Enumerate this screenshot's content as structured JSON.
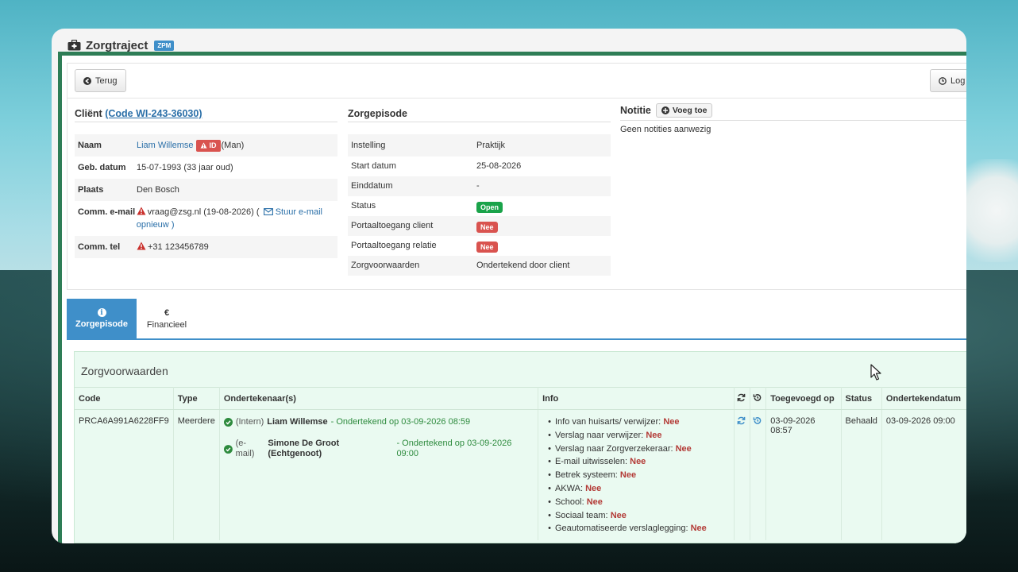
{
  "window": {
    "title": "Zorgtraject",
    "badge": "ZPM"
  },
  "toolbar": {
    "back_label": "Terug",
    "log_label": "Log"
  },
  "client": {
    "heading": "Cliënt",
    "code_link": "(Code WI-243-36030)",
    "rows": {
      "naam_label": "Naam",
      "naam_value": "Liam Willemse",
      "id_badge": "ID",
      "gender": "(Man)",
      "dob_label": "Geb. datum",
      "dob_value": "15-07-1993 (33 jaar oud)",
      "plaats_label": "Plaats",
      "plaats_value": "Den Bosch",
      "email_label": "Comm. e-mail",
      "email_value": "vraag@zsg.nl (19-08-2026) (",
      "email_link": "Stuur e-mail opnieuw",
      "email_suffix": ")",
      "tel_label": "Comm. tel",
      "tel_value": "+31 123456789"
    }
  },
  "episode": {
    "heading": "Zorgepisode",
    "rows": [
      {
        "label": "Instelling",
        "value": "Praktijk"
      },
      {
        "label": "Start datum",
        "value": "25-08-2026"
      },
      {
        "label": "Einddatum",
        "value": "-"
      },
      {
        "label": "Status",
        "badge": "Open"
      },
      {
        "label": "Portaaltoegang client",
        "badge": "Nee"
      },
      {
        "label": "Portaaltoegang relatie",
        "badge": "Nee"
      },
      {
        "label": "Zorgvoorwaarden",
        "value": "Ondertekend door client"
      }
    ]
  },
  "notes": {
    "heading": "Notitie",
    "add_label": "Voeg toe",
    "empty_text": "Geen notities aanwezig"
  },
  "tabs": [
    {
      "icon": "i",
      "label": "Zorgepisode"
    },
    {
      "icon": "€",
      "label": "Financieel"
    }
  ],
  "conditions": {
    "title": "Zorgvoorwaarden",
    "headers": {
      "code": "Code",
      "type": "Type",
      "signers": "Ondertekenaar(s)",
      "info": "Info",
      "added": "Toegevoegd op",
      "status": "Status",
      "signed_date": "Ondertekendatum"
    },
    "row": {
      "code": "PRCA6A991A6228FF9",
      "type": "Meerdere",
      "signers": [
        {
          "type": "(Intern)",
          "name": "Liam Willemse",
          "status": "- Ondertekend op 03-09-2026 08:59"
        },
        {
          "type": "(e-mail)",
          "name": "Simone De Groot (Echtgenoot)",
          "status": "- Ondertekend op 03-09-2026 09:00"
        }
      ],
      "info": [
        {
          "label": "Info van huisarts/ verwijzer:",
          "value": "Nee"
        },
        {
          "label": "Verslag naar verwijzer:",
          "value": "Nee"
        },
        {
          "label": "Verslag naar Zorgverzekeraar:",
          "value": "Nee"
        },
        {
          "label": "E-mail uitwisselen:",
          "value": "Nee"
        },
        {
          "label": "Betrek systeem:",
          "value": "Nee"
        },
        {
          "label": "AKWA:",
          "value": "Nee"
        },
        {
          "label": "School:",
          "value": "Nee"
        },
        {
          "label": "Sociaal team:",
          "value": "Nee"
        },
        {
          "label": "Geautomatiseerde verslaglegging:",
          "value": "Nee"
        }
      ],
      "added": "03-09-2026 08:57",
      "status": "Behaald",
      "signed_date": "03-09-2026 09:00"
    }
  },
  "colors": {
    "accent": "#3f8fc9",
    "frame_green": "#2e7d56",
    "danger": "#d9534f",
    "success": "#1aa34a"
  }
}
